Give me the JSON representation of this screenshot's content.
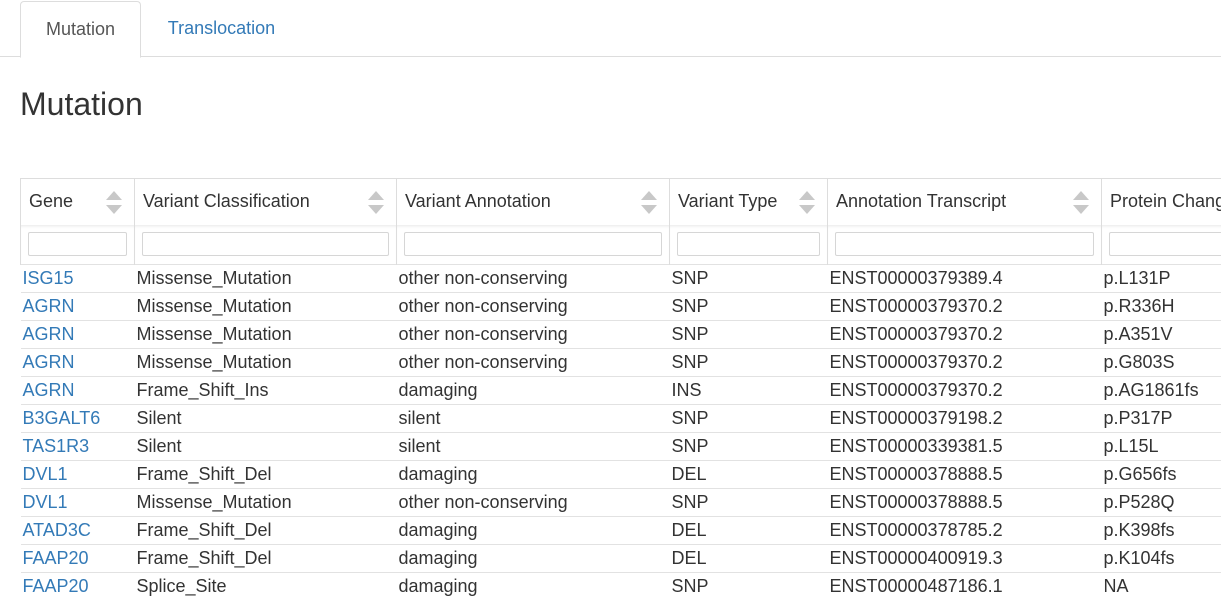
{
  "tabs": [
    {
      "label": "Mutation",
      "active": true
    },
    {
      "label": "Translocation",
      "active": false
    }
  ],
  "page_title": "Mutation",
  "table": {
    "columns": [
      {
        "label": "Gene",
        "sortable": true
      },
      {
        "label": "Variant Classification",
        "sortable": true
      },
      {
        "label": "Variant Annotation",
        "sortable": true
      },
      {
        "label": "Variant Type",
        "sortable": true
      },
      {
        "label": "Annotation Transcript",
        "sortable": true
      },
      {
        "label": "Protein Change",
        "sortable": true
      }
    ],
    "filters": [
      "",
      "",
      "",
      "",
      "",
      ""
    ],
    "rows": [
      [
        "ISG15",
        "Missense_Mutation",
        "other non-conserving",
        "SNP",
        "ENST00000379389.4",
        "p.L131P"
      ],
      [
        "AGRN",
        "Missense_Mutation",
        "other non-conserving",
        "SNP",
        "ENST00000379370.2",
        "p.R336H"
      ],
      [
        "AGRN",
        "Missense_Mutation",
        "other non-conserving",
        "SNP",
        "ENST00000379370.2",
        "p.A351V"
      ],
      [
        "AGRN",
        "Missense_Mutation",
        "other non-conserving",
        "SNP",
        "ENST00000379370.2",
        "p.G803S"
      ],
      [
        "AGRN",
        "Frame_Shift_Ins",
        "damaging",
        "INS",
        "ENST00000379370.2",
        "p.AG1861fs"
      ],
      [
        "B3GALT6",
        "Silent",
        "silent",
        "SNP",
        "ENST00000379198.2",
        "p.P317P"
      ],
      [
        "TAS1R3",
        "Silent",
        "silent",
        "SNP",
        "ENST00000339381.5",
        "p.L15L"
      ],
      [
        "DVL1",
        "Frame_Shift_Del",
        "damaging",
        "DEL",
        "ENST00000378888.5",
        "p.G656fs"
      ],
      [
        "DVL1",
        "Missense_Mutation",
        "other non-conserving",
        "SNP",
        "ENST00000378888.5",
        "p.P528Q"
      ],
      [
        "ATAD3C",
        "Frame_Shift_Del",
        "damaging",
        "DEL",
        "ENST00000378785.2",
        "p.K398fs"
      ],
      [
        "FAAP20",
        "Frame_Shift_Del",
        "damaging",
        "DEL",
        "ENST00000400919.3",
        "p.K104fs"
      ],
      [
        "FAAP20",
        "Splice_Site",
        "damaging",
        "SNP",
        "ENST00000487186.1",
        "NA"
      ]
    ]
  },
  "colors": {
    "link": "#337ab7",
    "text": "#333333",
    "border": "#dddddd",
    "sort_arrow": "#c8c8c8"
  },
  "icons": {
    "sort": "sort-arrows-icon"
  }
}
